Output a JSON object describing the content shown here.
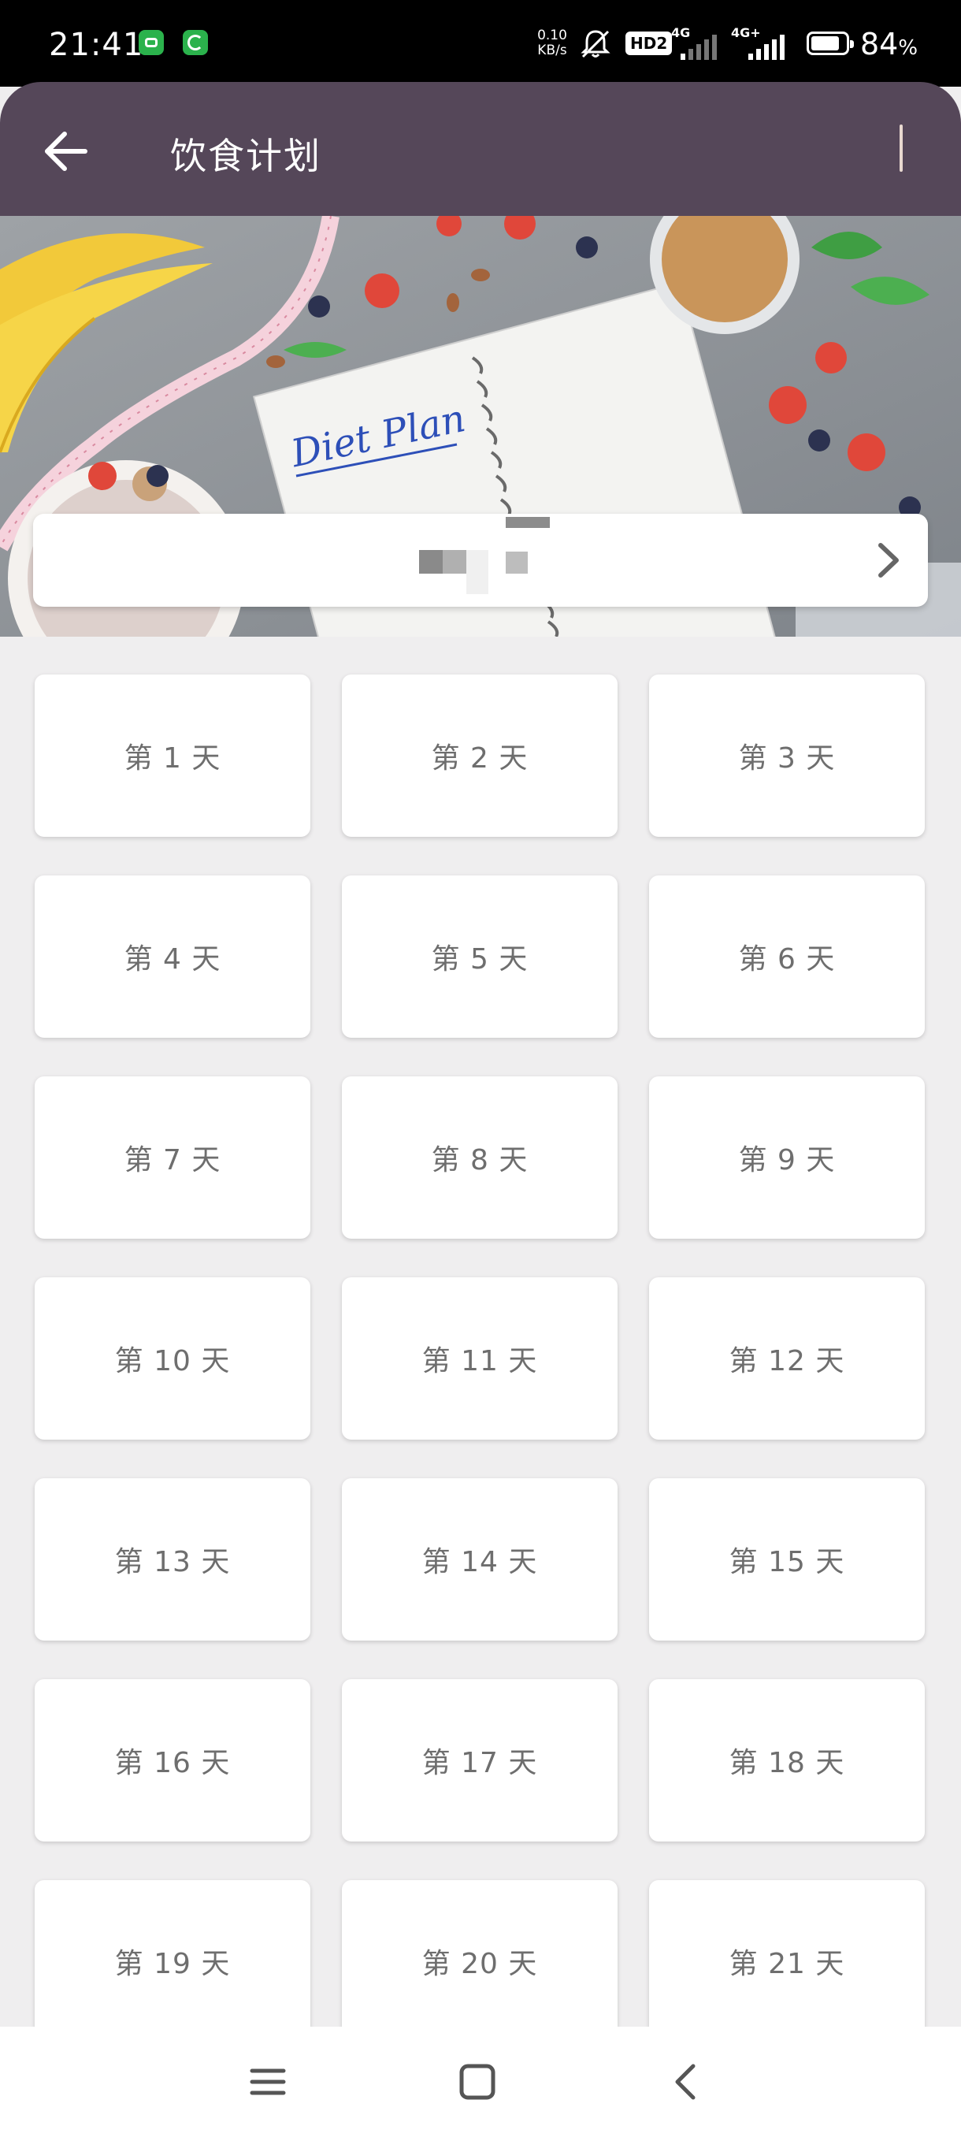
{
  "status_bar": {
    "time": "21:41",
    "net_speed_value": "0.10",
    "net_speed_unit": "KB/s",
    "hd_label": "HD2",
    "sim1_label": "4G",
    "sim2_label": "4G+",
    "battery_level": 84,
    "battery_number": "84",
    "battery_unit": "%"
  },
  "app_bar": {
    "title": "饮食计划"
  },
  "banner": {
    "notebook_text": "Diet Plan",
    "card_label": ""
  },
  "days": [
    {
      "label": "第 1 天"
    },
    {
      "label": "第 2 天"
    },
    {
      "label": "第 3 天"
    },
    {
      "label": "第 4 天"
    },
    {
      "label": "第 5 天"
    },
    {
      "label": "第 6 天"
    },
    {
      "label": "第 7 天"
    },
    {
      "label": "第 8 天"
    },
    {
      "label": "第 9 天"
    },
    {
      "label": "第 10 天"
    },
    {
      "label": "第 11 天"
    },
    {
      "label": "第 12 天"
    },
    {
      "label": "第 13 天"
    },
    {
      "label": "第 14 天"
    },
    {
      "label": "第 15 天"
    },
    {
      "label": "第 16 天"
    },
    {
      "label": "第 17 天"
    },
    {
      "label": "第 18 天"
    },
    {
      "label": "第 19 天"
    },
    {
      "label": "第 20 天"
    },
    {
      "label": "第 21 天"
    }
  ],
  "colors": {
    "app_bar": "#554759",
    "background": "#efeeef",
    "card": "#ffffff",
    "day_text": "#6e6e6e"
  },
  "icons": {
    "back": "arrow-left-icon",
    "chevron": "chevron-right-icon",
    "nav_menu": "menu-icon",
    "nav_home": "square-home-icon",
    "nav_back": "chevron-left-icon"
  }
}
